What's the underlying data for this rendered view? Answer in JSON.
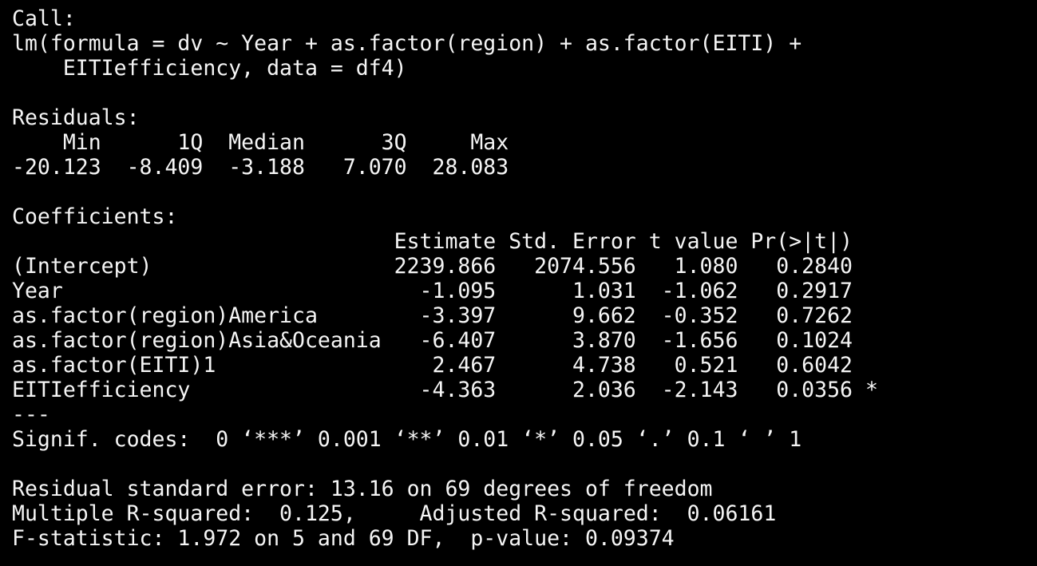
{
  "console": {
    "text_color": "#f5f5f5",
    "background_color": "#000000",
    "lines": [
      "Call:",
      "lm(formula = dv ~ Year + as.factor(region) + as.factor(EITI) + ",
      "    EITIefficiency, data = df4)",
      "",
      "Residuals:",
      "    Min      1Q  Median      3Q     Max ",
      "-20.123  -8.409  -3.188   7.070  28.083 ",
      "",
      "Coefficients:",
      "                              Estimate Std. Error t value Pr(>|t|)  ",
      "(Intercept)                   2239.866   2074.556   1.080   0.2840  ",
      "Year                            -1.095      1.031  -1.062   0.2917  ",
      "as.factor(region)America        -3.397      9.662  -0.352   0.7262  ",
      "as.factor(region)Asia&Oceania   -6.407      3.870  -1.656   0.1024  ",
      "as.factor(EITI)1                 2.467      4.738   0.521   0.6042  ",
      "EITIefficiency                  -4.363      2.036  -2.143   0.0356 *",
      "---",
      "Signif. codes:  0 ‘***’ 0.001 ‘**’ 0.01 ‘*’ 0.05 ‘.’ 0.1 ‘ ’ 1",
      "",
      "Residual standard error: 13.16 on 69 degrees of freedom",
      "Multiple R-squared:  0.125,\tAdjusted R-squared:  0.06161 ",
      "F-statistic: 1.972 on 5 and 69 DF,  p-value: 0.09374"
    ]
  }
}
